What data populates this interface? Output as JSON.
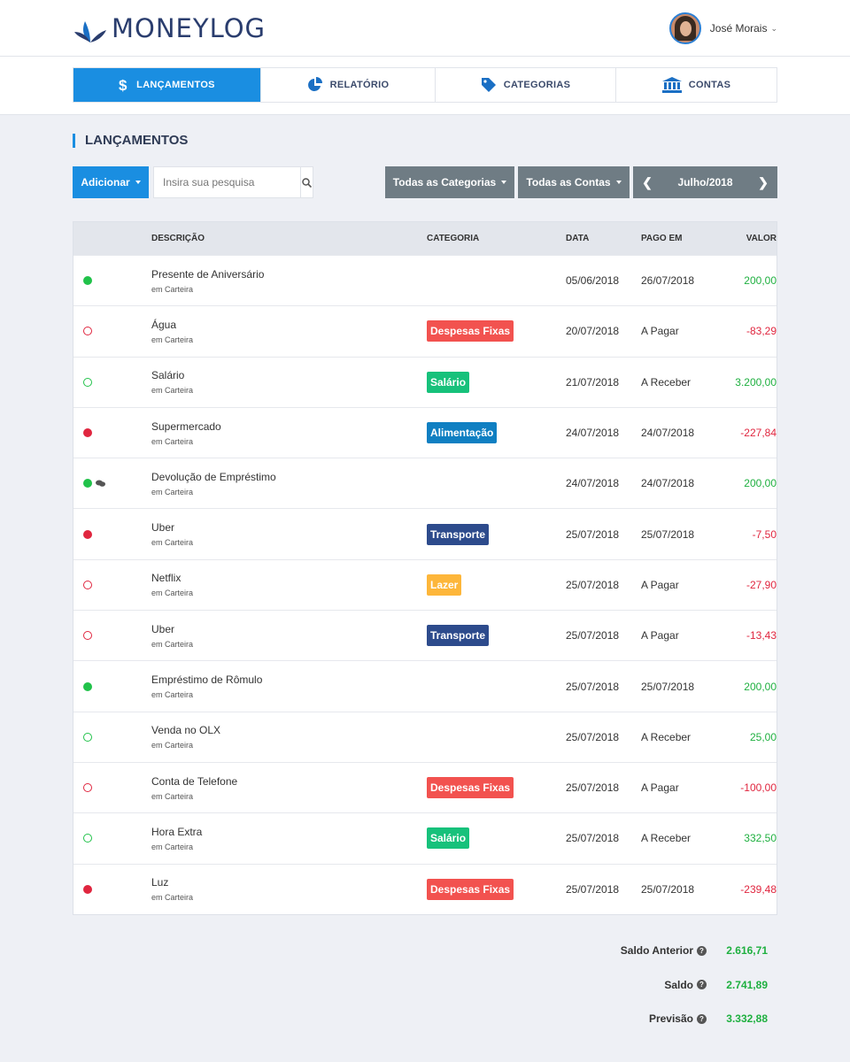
{
  "app": {
    "title": "MONEYLOG"
  },
  "user": {
    "name": "José Morais"
  },
  "nav": [
    {
      "label": "LANÇAMENTOS",
      "icon": "dollar-icon",
      "active": true
    },
    {
      "label": "RELATÓRIO",
      "icon": "pie-chart-icon",
      "active": false
    },
    {
      "label": "CATEGORIAS",
      "icon": "tag-icon",
      "active": false
    },
    {
      "label": "CONTAS",
      "icon": "bank-icon",
      "active": false
    }
  ],
  "section": {
    "title": "LANÇAMENTOS"
  },
  "toolbar": {
    "add_label": "Adicionar",
    "search_placeholder": "Insira sua pesquisa",
    "categories_label": "Todas as Categorias",
    "accounts_label": "Todas as Contas",
    "month_label": "Julho/2018"
  },
  "table": {
    "headers": {
      "description": "DESCRIÇÃO",
      "category": "CATEGORIA",
      "date": "DATA",
      "paid_on": "PAGO EM",
      "value": "VALOR"
    },
    "rows": [
      {
        "status": "paid-in",
        "description": "Presente de Aniversário",
        "account": "em Carteira",
        "category": "",
        "date": "05/06/2018",
        "paid_on": "26/07/2018",
        "value": "200,00",
        "sign": "pos"
      },
      {
        "status": "open-out",
        "description": "Água",
        "account": "em Carteira",
        "category": "Despesas Fixas",
        "date": "20/07/2018",
        "paid_on": "A Pagar",
        "value": "-83,29",
        "sign": "neg"
      },
      {
        "status": "open-in",
        "description": "Salário",
        "account": "em Carteira",
        "category": "Salário",
        "date": "21/07/2018",
        "paid_on": "A Receber",
        "value": "3.200,00",
        "sign": "pos"
      },
      {
        "status": "paid-out",
        "description": "Supermercado",
        "account": "em Carteira",
        "category": "Alimentação",
        "date": "24/07/2018",
        "paid_on": "24/07/2018",
        "value": "-227,84",
        "sign": "neg"
      },
      {
        "status": "paid-in",
        "comment": true,
        "description": "Devolução de Empréstimo",
        "account": "em Carteira",
        "category": "",
        "date": "24/07/2018",
        "paid_on": "24/07/2018",
        "value": "200,00",
        "sign": "pos"
      },
      {
        "status": "paid-out",
        "description": "Uber",
        "account": "em Carteira",
        "category": "Transporte",
        "date": "25/07/2018",
        "paid_on": "25/07/2018",
        "value": "-7,50",
        "sign": "neg"
      },
      {
        "status": "open-out",
        "description": "Netflix",
        "account": "em Carteira",
        "category": "Lazer",
        "date": "25/07/2018",
        "paid_on": "A Pagar",
        "value": "-27,90",
        "sign": "neg"
      },
      {
        "status": "open-out",
        "description": "Uber",
        "account": "em Carteira",
        "category": "Transporte",
        "date": "25/07/2018",
        "paid_on": "A Pagar",
        "value": "-13,43",
        "sign": "neg"
      },
      {
        "status": "paid-in",
        "description": "Empréstimo de Rômulo",
        "account": "em Carteira",
        "category": "",
        "date": "25/07/2018",
        "paid_on": "25/07/2018",
        "value": "200,00",
        "sign": "pos"
      },
      {
        "status": "open-in",
        "description": "Venda no OLX",
        "account": "em Carteira",
        "category": "",
        "date": "25/07/2018",
        "paid_on": "A Receber",
        "value": "25,00",
        "sign": "pos"
      },
      {
        "status": "open-out",
        "description": "Conta de Telefone",
        "account": "em Carteira",
        "category": "Despesas Fixas",
        "date": "25/07/2018",
        "paid_on": "A Pagar",
        "value": "-100,00",
        "sign": "neg"
      },
      {
        "status": "open-in",
        "description": "Hora Extra",
        "account": "em Carteira",
        "category": "Salário",
        "date": "25/07/2018",
        "paid_on": "A Receber",
        "value": "332,50",
        "sign": "pos"
      },
      {
        "status": "paid-out",
        "description": "Luz",
        "account": "em Carteira",
        "category": "Despesas Fixas",
        "date": "25/07/2018",
        "paid_on": "25/07/2018",
        "value": "-239,48",
        "sign": "neg"
      }
    ]
  },
  "category_colors": {
    "Despesas Fixas": "#f2524f",
    "Salário": "#17c17b",
    "Alimentação": "#0f7fc2",
    "Transporte": "#2d4b8c",
    "Lazer": "#fdb63a"
  },
  "totals": [
    {
      "label": "Saldo Anterior",
      "value": "2.616,71"
    },
    {
      "label": "Saldo",
      "value": "2.741,89"
    },
    {
      "label": "Previsão",
      "value": "3.332,88"
    }
  ],
  "colors": {
    "accent": "#1a8ee1",
    "positive": "#1fb040",
    "negative": "#e0263f",
    "brand": "#2a3d6e"
  }
}
